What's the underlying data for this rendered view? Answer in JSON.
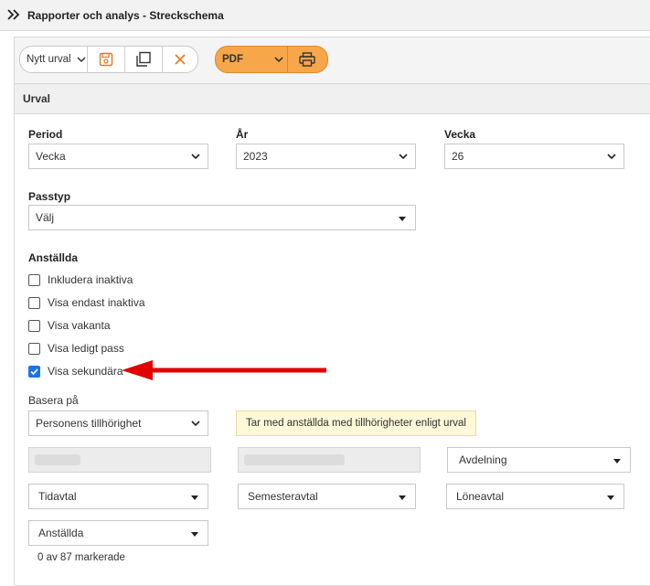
{
  "titlebar": {
    "icon": "double-chevron-right-icon",
    "title": "Rapporter och analys - Streckschema"
  },
  "toolbar": {
    "selection_label": "Nytt urval",
    "pdf_label": "PDF",
    "icons": [
      "save-icon",
      "copy-icon",
      "close-icon",
      "printer-icon"
    ],
    "accent": "#f7a64a"
  },
  "section": {
    "title": "Urval"
  },
  "period": {
    "label": "Period",
    "value": "Vecka"
  },
  "year": {
    "label": "År",
    "value": "2023"
  },
  "week": {
    "label": "Vecka",
    "value": "26"
  },
  "passtyp": {
    "label": "Passtyp",
    "value": "Välj"
  },
  "employees": {
    "label": "Anställda",
    "options": [
      {
        "label": "Inkludera inaktiva",
        "checked": false
      },
      {
        "label": "Visa endast inaktiva",
        "checked": false
      },
      {
        "label": "Visa vakanta",
        "checked": false
      },
      {
        "label": "Visa ledigt pass",
        "checked": false
      },
      {
        "label": "Visa sekundära",
        "checked": true
      }
    ]
  },
  "base": {
    "label": "Basera på",
    "value": "Personens tillhörighet",
    "info": "Tar med anställda med tillhörigheter enligt urval"
  },
  "filters": {
    "avdelning": "Avdelning",
    "tidavtal": "Tidavtal",
    "semesteravtal": "Semesteravtal",
    "loneavtal": "Löneavtal",
    "anstallda": "Anställda",
    "count": "0 av 87 markerade"
  }
}
